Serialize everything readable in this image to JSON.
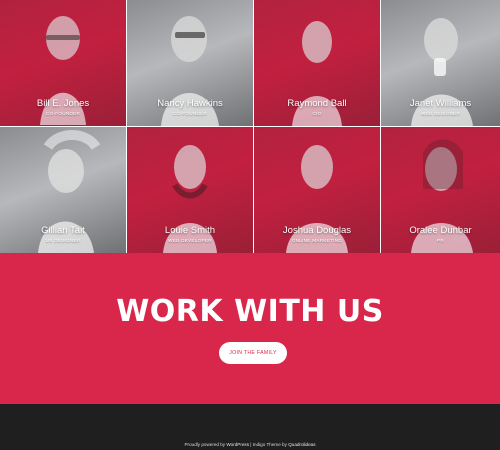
{
  "team": {
    "members": [
      {
        "name": "Bill E. Jones",
        "role": "CO-FOUNDER"
      },
      {
        "name": "Nancy Hawkins",
        "role": "CO-FOUNDER"
      },
      {
        "name": "Raymond Ball",
        "role": "CIO"
      },
      {
        "name": "Janet Williams",
        "role": "WEB DESIGNER"
      },
      {
        "name": "Gillian Tait",
        "role": "UX DESIGNER"
      },
      {
        "name": "Louie Smith",
        "role": "WEB DEVELOPER"
      },
      {
        "name": "Joshua Douglas",
        "role": "ONLINE MARKETING"
      },
      {
        "name": "Oralee Dunbar",
        "role": "PR"
      }
    ]
  },
  "cta": {
    "title": "WORK WITH US",
    "button": "JOIN THE FAMILY"
  },
  "footer": {
    "prefix": "Proudly powered by ",
    "link1": "WordPress",
    "separator": " | Indigo Theme by ",
    "link2": "Quadrolideas"
  },
  "colors": {
    "accent": "#d9264b",
    "footer": "#1f1f1f",
    "white": "#ffffff"
  },
  "icons": {
    "portrait": "person-portrait-icon"
  }
}
